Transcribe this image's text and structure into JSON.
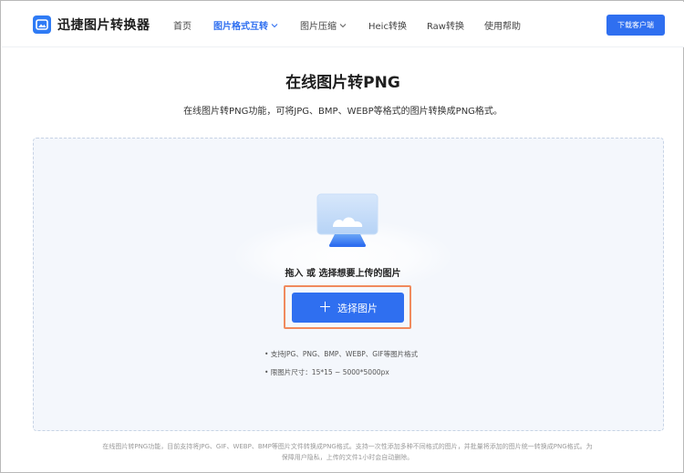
{
  "header": {
    "brand": "迅捷图片转换器",
    "nav": [
      {
        "label": "首页",
        "active": false,
        "dropdown": false
      },
      {
        "label": "图片格式互转",
        "active": true,
        "dropdown": true
      },
      {
        "label": "图片压缩",
        "active": false,
        "dropdown": true
      },
      {
        "label": "Heic转换",
        "active": false,
        "dropdown": false
      },
      {
        "label": "Raw转换",
        "active": false,
        "dropdown": false
      },
      {
        "label": "使用帮助",
        "active": false,
        "dropdown": false
      }
    ],
    "download_label": "下载客户端"
  },
  "main": {
    "title": "在线图片转PNG",
    "subtitle": "在线图片转PNG功能，可将JPG、BMP、WEBP等格式的图片转换成PNG格式。",
    "drop_hint": "拖入 或 选择想要上传的图片",
    "select_button": {
      "icon": "plus-icon",
      "label": "选择图片"
    },
    "rules": [
      "• 支持JPG、PNG、BMP、WEBP、GIF等图片格式",
      "• 限图片尺寸：15*15 ~ 5000*5000px"
    ]
  },
  "footer": {
    "line1": "在线图片转PNG功能，目前支持将JPG、GIF、WEBP、BMP等图片文件转换成PNG格式。支持一次性添加多种不同格式的图片，并批量将添加的图片统一转换成PNG格式。为",
    "line2": "保障用户隐私，上传的文件1小时会自动删除。"
  },
  "colors": {
    "accent": "#2f6ff0",
    "highlight": "#f08a5d",
    "drop_bg": "#f4f7fc"
  }
}
